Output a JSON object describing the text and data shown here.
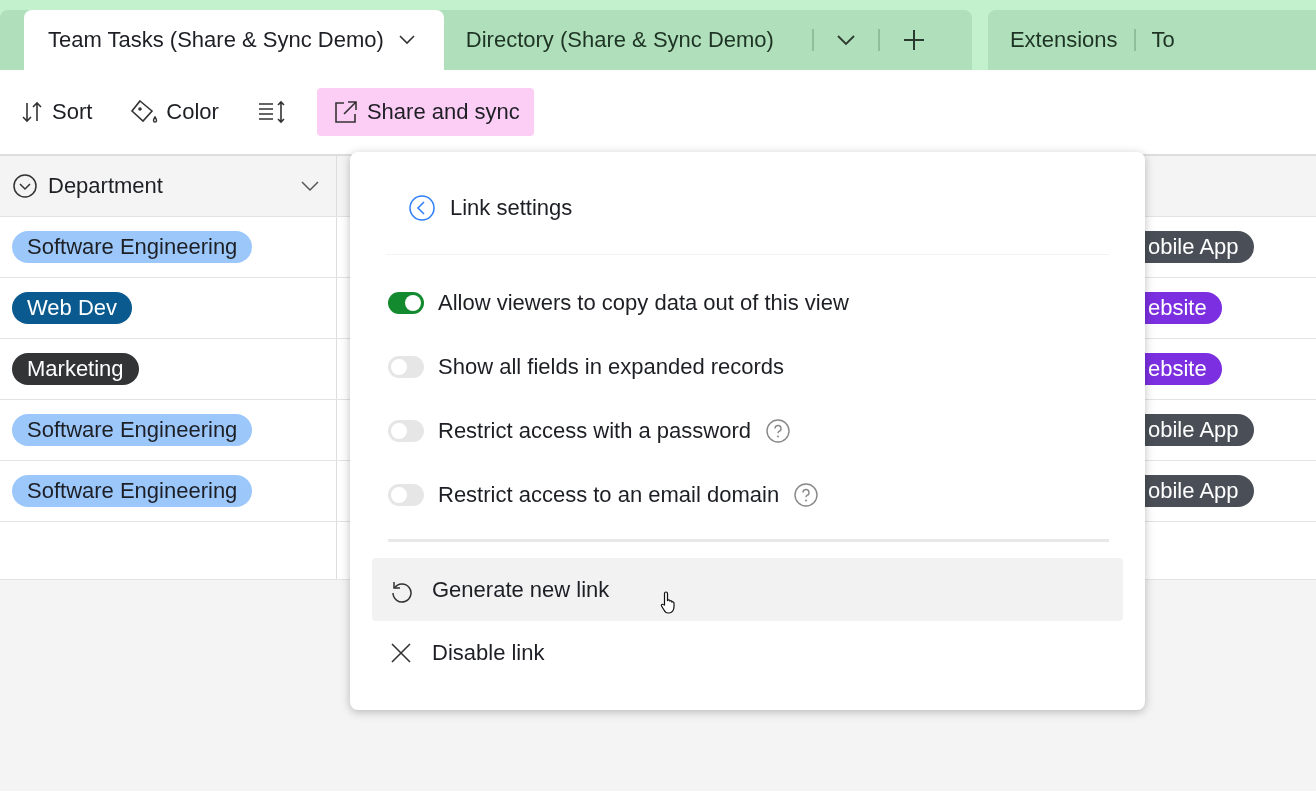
{
  "tabs": [
    {
      "label": "Team Tasks (Share & Sync Demo)",
      "selected": true
    },
    {
      "label": "Directory (Share & Sync Demo)",
      "selected": false
    }
  ],
  "right_tabs": [
    "Extensions",
    "To"
  ],
  "toolbar": [
    {
      "kind": "sort",
      "label": "Sort",
      "active": false
    },
    {
      "kind": "color",
      "label": "Color",
      "active": false
    },
    {
      "kind": "height",
      "active": false
    },
    {
      "kind": "share",
      "label": "Share and sync",
      "active": true
    }
  ],
  "table": {
    "columns": [
      {
        "name": "Department"
      }
    ],
    "rows": [
      {
        "department": {
          "label": "Software Engineering",
          "color": "#9cc7fb"
        },
        "column_3": {
          "label": "obile App",
          "color": "#4a4f57"
        }
      },
      {
        "department": {
          "label": "Web Dev",
          "color": "#0b5a8f"
        },
        "column_3": {
          "label": "ebsite",
          "color": "#7b2fe0"
        }
      },
      {
        "department": {
          "label": "Marketing",
          "color": "#333436"
        },
        "column_3": {
          "label": "ebsite",
          "color": "#7b2fe0"
        }
      },
      {
        "department": {
          "label": "Software Engineering",
          "color": "#9cc7fb"
        },
        "column_3": {
          "label": "obile App",
          "color": "#4a4f57"
        }
      },
      {
        "department": {
          "label": "Software Engineering",
          "color": "#9cc7fb"
        },
        "column_3": {
          "label": "obile App",
          "color": "#4a4f57"
        }
      }
    ]
  },
  "popup": {
    "title": "Link settings",
    "options": [
      {
        "label": "Allow viewers to copy data out of this view",
        "on": true,
        "help": false
      },
      {
        "label": "Show all fields in expanded records",
        "on": false,
        "help": false
      },
      {
        "label": "Restrict access with a password",
        "on": false,
        "help": true
      },
      {
        "label": "Restrict access to an email domain",
        "on": false,
        "help": true
      }
    ],
    "actions": [
      {
        "kind": "regenerate",
        "label": "Generate new link",
        "highlighted": true
      },
      {
        "kind": "disable",
        "label": "Disable link",
        "highlighted": false
      }
    ]
  }
}
